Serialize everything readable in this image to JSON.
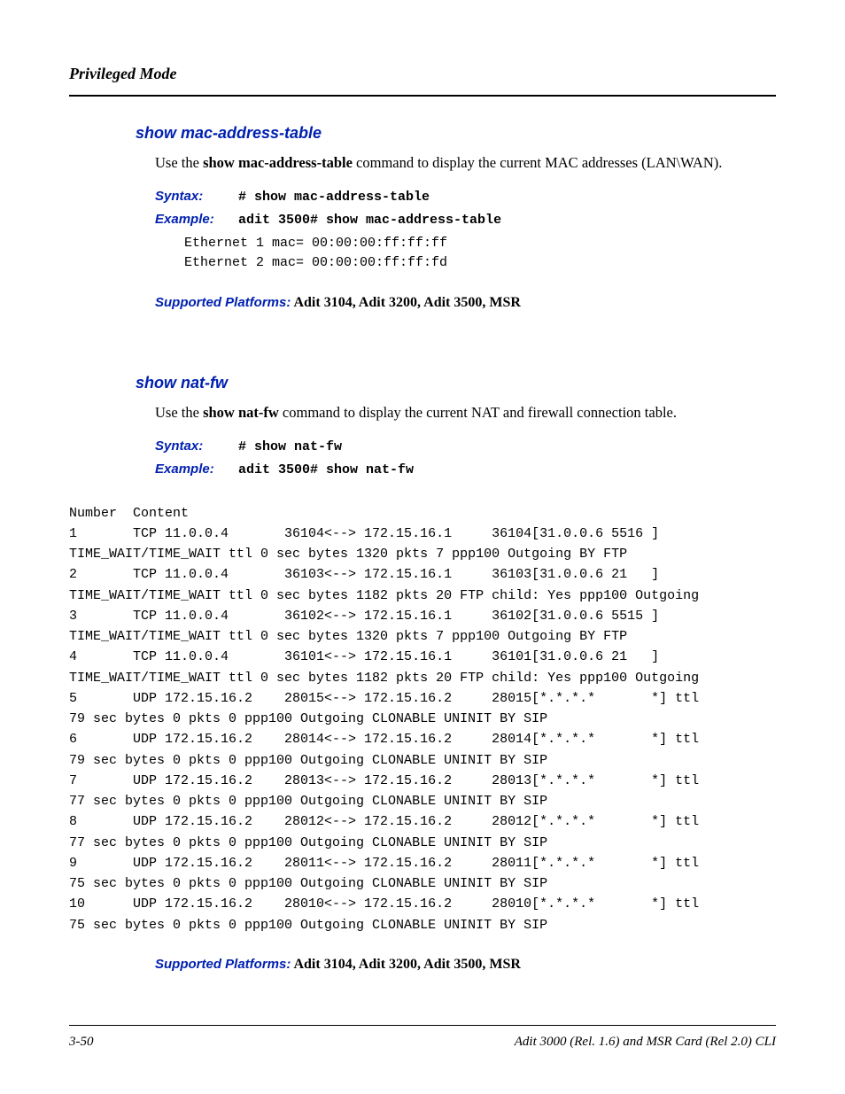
{
  "header": {
    "title": "Privileged Mode"
  },
  "sections": [
    {
      "title": "show mac-address-table",
      "desc_prefix": "Use the ",
      "desc_bold": "show mac-address-table",
      "desc_suffix": " command to display the current MAC addresses (LAN\\WAN).",
      "syntax_label": "Syntax:",
      "syntax_code": "# show mac-address-table",
      "example_label": "Example:",
      "example_code": "adit 3500# show mac-address-table",
      "example_output": "Ethernet 1 mac= 00:00:00:ff:ff:ff\nEthernet 2 mac= 00:00:00:ff:ff:fd",
      "platforms_label": "Supported Platforms:",
      "platforms_value": "  Adit 3104, Adit 3200, Adit 3500, MSR"
    },
    {
      "title": "show nat-fw",
      "desc_prefix": "Use the ",
      "desc_bold": "show nat-fw",
      "desc_suffix": " command to display the current NAT and firewall connection table.",
      "syntax_label": "Syntax:",
      "syntax_code": "# show nat-fw",
      "example_label": "Example:",
      "example_code": "adit 3500# show nat-fw",
      "terminal": "Number  Content\n1       TCP 11.0.0.4       36104<--> 172.15.16.1     36104[31.0.0.6 5516 ] \nTIME_WAIT/TIME_WAIT ttl 0 sec bytes 1320 pkts 7 ppp100 Outgoing BY FTP\n2       TCP 11.0.0.4       36103<--> 172.15.16.1     36103[31.0.0.6 21   ] \nTIME_WAIT/TIME_WAIT ttl 0 sec bytes 1182 pkts 20 FTP child: Yes ppp100 Outgoing\n3       TCP 11.0.0.4       36102<--> 172.15.16.1     36102[31.0.0.6 5515 ] \nTIME_WAIT/TIME_WAIT ttl 0 sec bytes 1320 pkts 7 ppp100 Outgoing BY FTP\n4       TCP 11.0.0.4       36101<--> 172.15.16.1     36101[31.0.0.6 21   ] \nTIME_WAIT/TIME_WAIT ttl 0 sec bytes 1182 pkts 20 FTP child: Yes ppp100 Outgoing\n5       UDP 172.15.16.2    28015<--> 172.15.16.2     28015[*.*.*.*       *] ttl \n79 sec bytes 0 pkts 0 ppp100 Outgoing CLONABLE UNINIT BY SIP\n6       UDP 172.15.16.2    28014<--> 172.15.16.2     28014[*.*.*.*       *] ttl \n79 sec bytes 0 pkts 0 ppp100 Outgoing CLONABLE UNINIT BY SIP\n7       UDP 172.15.16.2    28013<--> 172.15.16.2     28013[*.*.*.*       *] ttl \n77 sec bytes 0 pkts 0 ppp100 Outgoing CLONABLE UNINIT BY SIP\n8       UDP 172.15.16.2    28012<--> 172.15.16.2     28012[*.*.*.*       *] ttl \n77 sec bytes 0 pkts 0 ppp100 Outgoing CLONABLE UNINIT BY SIP\n9       UDP 172.15.16.2    28011<--> 172.15.16.2     28011[*.*.*.*       *] ttl \n75 sec bytes 0 pkts 0 ppp100 Outgoing CLONABLE UNINIT BY SIP\n10      UDP 172.15.16.2    28010<--> 172.15.16.2     28010[*.*.*.*       *] ttl \n75 sec bytes 0 pkts 0 ppp100 Outgoing CLONABLE UNINIT BY SIP",
      "platforms_label": "Supported Platforms:",
      "platforms_value": "  Adit 3104, Adit 3200, Adit 3500, MSR"
    }
  ],
  "footer": {
    "page": "3-50",
    "doc": "Adit 3000 (Rel. 1.6) and MSR Card (Rel 2.0) CLI"
  }
}
